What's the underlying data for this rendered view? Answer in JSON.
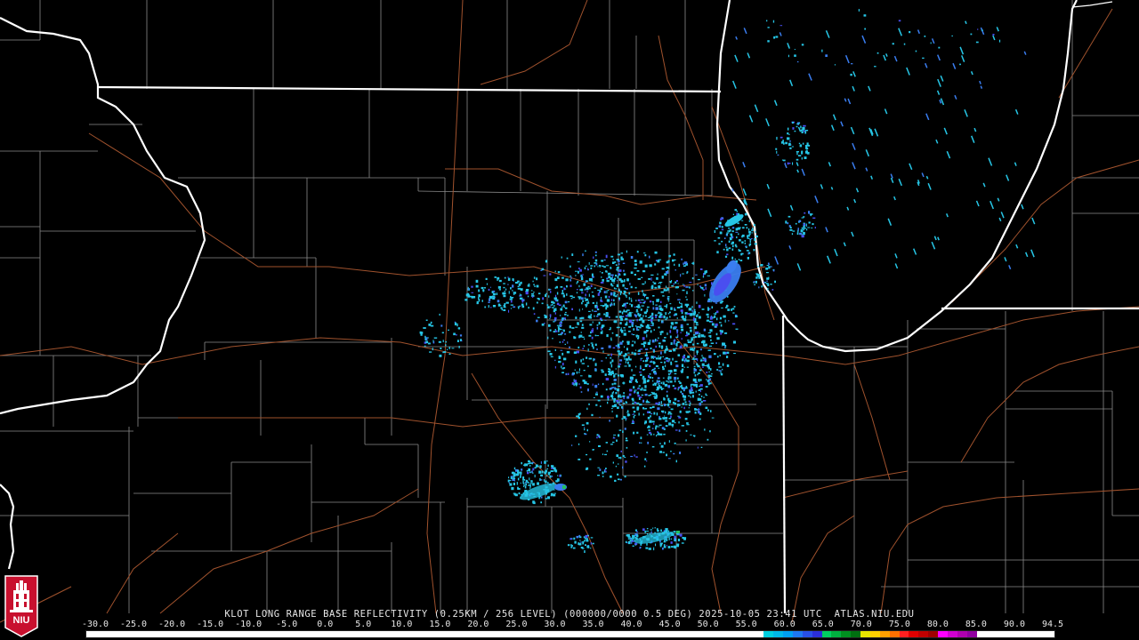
{
  "product_caption": "KLOT LONG RANGE BASE REFLECTIVITY (0.25KM / 256 LEVEL) (000000/0000 0.5 DEG) 2025-10-05 23:41 UTC  ATLAS.NIU.EDU",
  "logo": {
    "text": "NIU",
    "icon": "niu-tower-logo",
    "color": "#c8102e"
  },
  "legend": {
    "values": [
      "-30.0",
      "-25.0",
      "-20.0",
      "-15.0",
      "-10.0",
      "-5.0",
      "0.0",
      "5.0",
      "10.0",
      "15.0",
      "20.0",
      "25.0",
      "30.0",
      "35.0",
      "40.0",
      "45.0",
      "50.0",
      "55.0",
      "60.0",
      "65.0",
      "70.0",
      "75.0",
      "80.0",
      "85.0",
      "90.0",
      "94.5"
    ],
    "colors": [
      "#ffffff",
      "#ffffff",
      "#ffffff",
      "#ffffff",
      "#ffffff",
      "#ffffff",
      "#ffffff",
      "#ffffff",
      "#ffffff",
      "#ffffff",
      "#ffffff",
      "#ffffff",
      "#ffffff",
      "#ffffff",
      "#ffffff",
      "#ffffff",
      "#ffffff",
      "#ffffff",
      "#ffffff",
      "#ffffff",
      "#ffffff",
      "#ffffff",
      "#ffffff",
      "#ffffff",
      "#ffffff",
      "#ffffff",
      "#ffffff",
      "#ffffff",
      "#ffffff",
      "#ffffff",
      "#ffffff",
      "#ffffff",
      "#ffffff",
      "#ffffff",
      "#ffffff",
      "#ffffff",
      "#ffffff",
      "#ffffff",
      "#ffffff",
      "#ffffff",
      "#ffffff",
      "#ffffff",
      "#ffffff",
      "#ffffff",
      "#ffffff",
      "#ffffff",
      "#ffffff",
      "#ffffff",
      "#ffffff",
      "#ffffff",
      "#ffffff",
      "#ffffff",
      "#ffffff",
      "#ffffff",
      "#ffffff",
      "#ffffff",
      "#ffffff",
      "#ffffff",
      "#ffffff",
      "#ffffff",
      "#ffffff",
      "#ffffff",
      "#ffffff",
      "#ffffff",
      "#ffffff",
      "#ffffff",
      "#ffffff",
      "#ffffff",
      "#ffffff",
      "#ffffff",
      "#00cfe0",
      "#00b8e8",
      "#00a0f0",
      "#1e78f0",
      "#2850e6",
      "#2b2fd8",
      "#00d060",
      "#00b040",
      "#009020",
      "#007010",
      "#e6e600",
      "#ffd000",
      "#ffa000",
      "#ff7000",
      "#ff2020",
      "#e00000",
      "#c00000",
      "#a00000",
      "#ff00ff",
      "#d000d0",
      "#b000b0",
      "#9000a0",
      "#ffffff",
      "#ffffff",
      "#ffffff",
      "#ffffff",
      "#ffffff",
      "#ffffff",
      "#ffffff",
      "#ffffff"
    ]
  },
  "map_colors": {
    "state_border": "#ffffff",
    "county_border": "#8a8a8a",
    "highway": "#a0522d",
    "echo_light": "#26c6e6",
    "echo_medium": "#3a7df0",
    "echo_heavy": "#4a4ef0",
    "echo_green": "#22c060"
  }
}
